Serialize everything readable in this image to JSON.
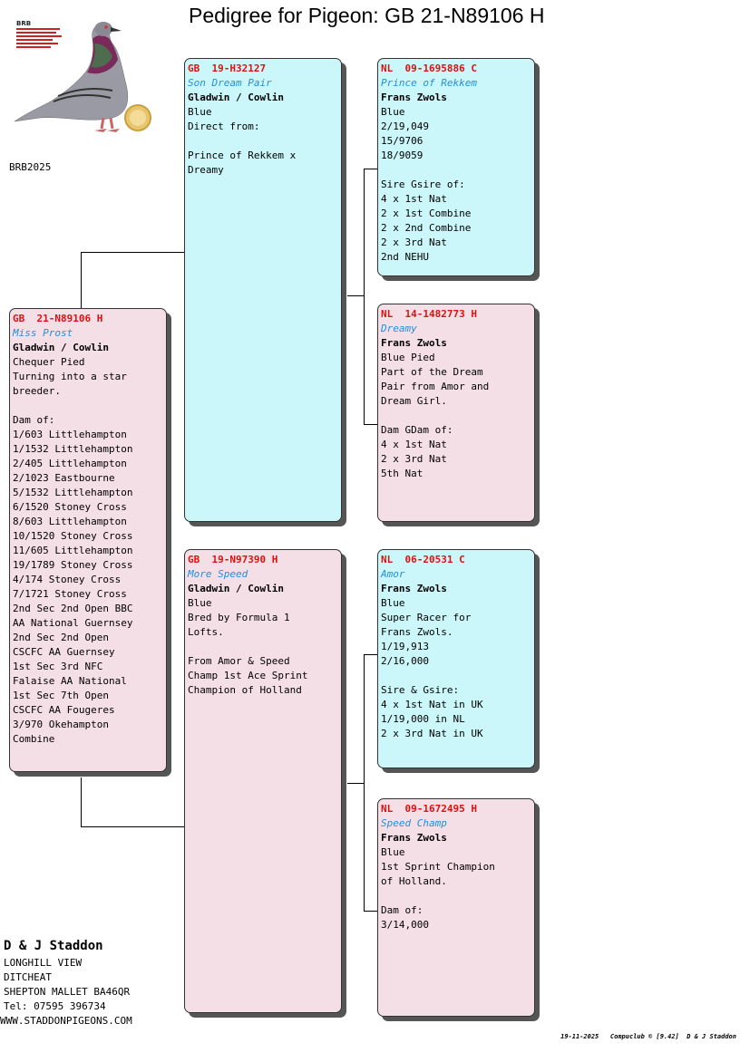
{
  "title": "Pedigree for Pigeon: GB  21-N89106 H",
  "logo_text": "BRB",
  "brb_code": "BRB2025",
  "subject": {
    "ring": "GB  21-N89106 H",
    "name": "Miss Prost",
    "breeder": "Gladwin / Cowlin",
    "info": "Chequer Pied\nTurning into a star\nbreeder.\n\nDam of:\n1/603 Littlehampton\n1/1532 Littlehampton\n2/405 Littlehampton\n2/1023 Eastbourne\n5/1532 Littlehampton\n6/1520 Stoney Cross\n8/603 Littlehampton\n10/1520 Stoney Cross\n11/605 Littlehampton\n19/1789 Stoney Cross\n4/174 Stoney Cross\n7/1721 Stoney Cross\n2nd Sec 2nd Open BBC\nAA National Guernsey\n2nd Sec 2nd Open\nCSCFC AA Guernsey\n1st Sec 3rd NFC\nFalaise AA National\n1st Sec 7th Open\nCSCFC AA Fougeres\n3/970 Okehampton\nCombine"
  },
  "sire": {
    "ring": "GB  19-H32127",
    "name": "Son Dream Pair",
    "breeder": "Gladwin / Cowlin",
    "info": "Blue\nDirect from:\n\nPrince of Rekkem x\nDreamy"
  },
  "dam": {
    "ring": "GB  19-N97390 H",
    "name": "More Speed",
    "breeder": "Gladwin / Cowlin",
    "info": "Blue\nBred by Formula 1\nLofts.\n\nFrom Amor & Speed\nChamp 1st Ace Sprint\nChampion of Holland"
  },
  "sire_sire": {
    "ring": "NL  09-1695886 C",
    "name": "Prince of Rekkem",
    "breeder": "Frans Zwols",
    "info": "Blue\n2/19,049\n15/9706\n18/9059\n\nSire Gsire of:\n4 x 1st Nat\n2 x 1st Combine\n2 x 2nd Combine\n2 x 3rd Nat\n2nd NEHU"
  },
  "sire_dam": {
    "ring": "NL  14-1482773 H",
    "name": "Dreamy",
    "breeder": "Frans Zwols",
    "info": "Blue Pied\nPart of the Dream\nPair from Amor and\nDream Girl.\n\nDam GDam of:\n4 x 1st Nat\n2 x 3rd Nat\n5th Nat"
  },
  "dam_sire": {
    "ring": "NL  06-20531 C",
    "name": "Amor",
    "breeder": "Frans Zwols",
    "info": "Blue\nSuper Racer for\nFrans Zwols.\n1/19,913\n2/16,000\n\nSire & Gsire:\n4 x 1st Nat in UK\n1/19,000 in NL\n2 x 3rd Nat in UK"
  },
  "dam_dam": {
    "ring": "NL  09-1672495 H",
    "name": "Speed Champ",
    "breeder": "Frans Zwols",
    "info": "Blue\n1st Sprint Champion\nof Holland.\n\nDam of:\n3/14,000"
  },
  "owner": {
    "name": "D & J Staddon",
    "address1": "LONGHILL VIEW",
    "address2": "DITCHEAT",
    "address3": "SHEPTON MALLET BA46QR",
    "tel": "Tel: 07595 396734",
    "website": "WWW.STADDONPIGEONS.COM"
  },
  "footer": "19-11-2025   Compuclub © [9.42]  D & J Staddon",
  "colors": {
    "hen_card": "#f5dfe6",
    "cock_card": "#ccf7fa",
    "ring_text": "#dd1111",
    "name_text": "#1f8fe0"
  }
}
